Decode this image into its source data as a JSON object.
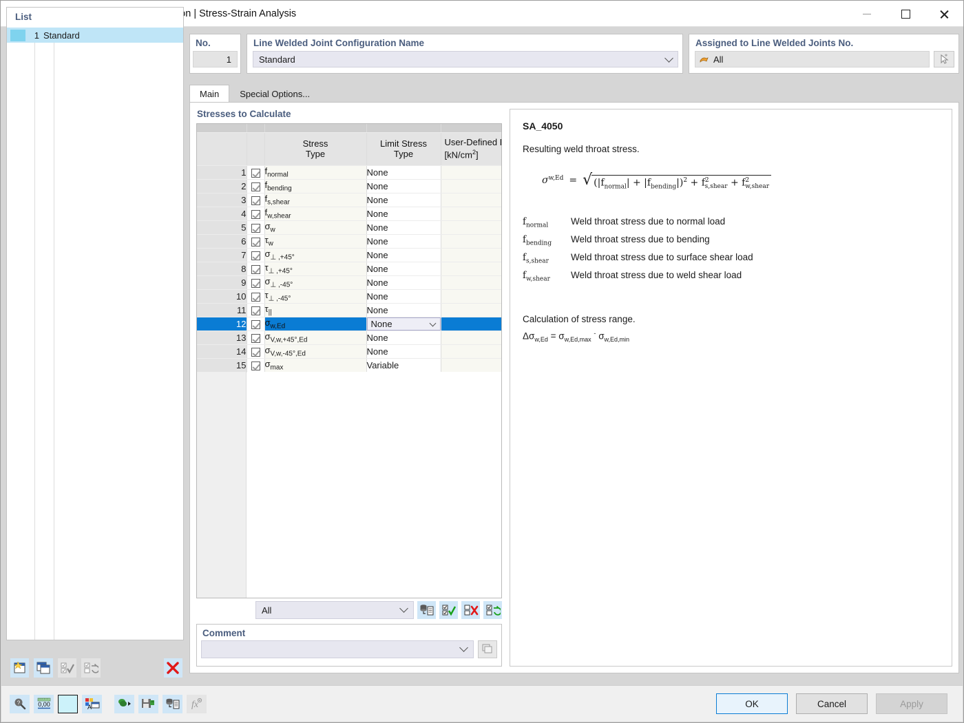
{
  "window": {
    "title": "New Line Welded Joint Configuration | Stress-Strain Analysis",
    "icon": "welded-joint-icon",
    "minimize": "minimize-icon",
    "maximize": "maximize-icon",
    "close": "close-icon"
  },
  "list": {
    "header": "List",
    "items": [
      {
        "number": "1",
        "name": "Standard"
      }
    ],
    "toolbar": [
      {
        "name": "new-item-button",
        "icon": "new-window-icon"
      },
      {
        "name": "copy-item-button",
        "icon": "copy-window-icon"
      },
      {
        "name": "select-all-button",
        "icon": "check-all-icon"
      },
      {
        "name": "invert-selection-button",
        "icon": "invert-check-icon"
      },
      {
        "name": "delete-item-button",
        "icon": "red-x-icon"
      }
    ]
  },
  "number_field": {
    "label": "No.",
    "value": "1"
  },
  "name_field": {
    "label": "Line Welded Joint Configuration Name",
    "value": "Standard",
    "chevron": "chevron-down-icon"
  },
  "assigned": {
    "label": "Assigned to Line Welded Joints No.",
    "value": "All",
    "value_icon": "selection-icon",
    "pick_button_icon": "pick-cursor-icon"
  },
  "tabs": [
    {
      "label": "Main",
      "active": true
    },
    {
      "label": "Special Options...",
      "active": false
    }
  ],
  "stresses": {
    "title": "Stresses to Calculate",
    "columns": {
      "number": "",
      "check": "",
      "type_line1": "Stress",
      "type_line2": "Type",
      "limit_line1": "Limit Stress",
      "limit_line2": "Type",
      "user_line1": "User-Defined L",
      "user_line2": "[kN/cm",
      "user_sup": "2",
      "user_line2_end": "]"
    },
    "rows": [
      {
        "no": "1",
        "checked": true,
        "type": "f",
        "sub": "normal",
        "limit": "None",
        "user": ""
      },
      {
        "no": "2",
        "checked": true,
        "type": "f",
        "sub": "bending",
        "limit": "None",
        "user": ""
      },
      {
        "no": "3",
        "checked": true,
        "type": "f",
        "sub": "s,shear",
        "limit": "None",
        "user": ""
      },
      {
        "no": "4",
        "checked": true,
        "type": "f",
        "sub": "w,shear",
        "limit": "None",
        "user": ""
      },
      {
        "no": "5",
        "checked": true,
        "type": "σ",
        "sub": "w",
        "limit": "None",
        "user": ""
      },
      {
        "no": "6",
        "checked": true,
        "type": "τ",
        "sub": "w",
        "limit": "None",
        "user": ""
      },
      {
        "no": "7",
        "checked": true,
        "type": "σ",
        "sub": "⊥ ,+45°",
        "limit": "None",
        "user": ""
      },
      {
        "no": "8",
        "checked": true,
        "type": "τ",
        "sub": "⊥ ,+45°",
        "limit": "None",
        "user": ""
      },
      {
        "no": "9",
        "checked": true,
        "type": "σ",
        "sub": "⊥ ,-45°",
        "limit": "None",
        "user": ""
      },
      {
        "no": "10",
        "checked": true,
        "type": "τ",
        "sub": "⊥ ,-45°",
        "limit": "None",
        "user": ""
      },
      {
        "no": "11",
        "checked": true,
        "type": "τ",
        "sub": "||",
        "limit": "None",
        "user": ""
      },
      {
        "no": "12",
        "checked": true,
        "type": "σ",
        "sub": "w,Ed",
        "limit": "None",
        "user": "",
        "selected": true
      },
      {
        "no": "13",
        "checked": true,
        "type": "σ",
        "sub": "V,w,+45°,Ed",
        "limit": "None",
        "user": ""
      },
      {
        "no": "14",
        "checked": true,
        "type": "σ",
        "sub": "V,w,-45°,Ed",
        "limit": "None",
        "user": ""
      },
      {
        "no": "15",
        "checked": true,
        "type": "σ",
        "sub": "max",
        "limit": "Variable",
        "user": ""
      }
    ],
    "filter": {
      "value": "All",
      "chevron": "chevron-down-icon"
    },
    "toolbar": [
      {
        "name": "import-from-library-button",
        "icon": "database-document-icon"
      },
      {
        "name": "check-all-button",
        "icon": "check-all-green-icon"
      },
      {
        "name": "uncheck-all-button",
        "icon": "uncheck-all-red-icon"
      },
      {
        "name": "invert-checks-button",
        "icon": "invert-checks-icon"
      }
    ]
  },
  "comment": {
    "label": "Comment",
    "value": "",
    "chevron": "chevron-down-icon",
    "button_icon": "comment-templates-icon"
  },
  "info": {
    "code": "SA_4050",
    "description": "Resulting weld throat stress.",
    "formula": {
      "lhs_sym": "σ",
      "lhs_sub": "w,Ed",
      "equals": "=",
      "radicand": "(|f_normal| + |f_bending|)² + f²_s,shear + f²_w,shear",
      "parts": {
        "open": "(|f",
        "p1sub": "normal",
        "bar1": "| + |f",
        "p2sub": "bending",
        "close": "|)",
        "sq": "2",
        "plus1": "+ f",
        "p3sub": "s,shear",
        "plus2": "+ f",
        "p4sub": "w,shear"
      }
    },
    "legend": [
      {
        "sym": "f",
        "sub": "normal",
        "text": "Weld throat stress due to normal load"
      },
      {
        "sym": "f",
        "sub": "bending",
        "text": "Weld throat stress due to bending"
      },
      {
        "sym": "f",
        "sub": "s,shear",
        "text": "Weld throat stress due to surface shear load"
      },
      {
        "sym": "f",
        "sub": "w,shear",
        "text": "Weld throat stress due to weld shear load"
      }
    ],
    "range_title": "Calculation of stress range.",
    "range_formula": {
      "delta": "Δσ",
      "delta_sub": "w,Ed",
      "eq": "=",
      "max_sym": "σ",
      "max_sub": "w,Ed,max",
      "minus": "-",
      "min_sym": "σ",
      "min_sub": "w,Ed,min"
    }
  },
  "statusbar": {
    "icons": [
      {
        "name": "info-search-button",
        "icon": "magnifier-question-icon"
      },
      {
        "name": "units-button",
        "icon": "number-format-icon"
      },
      {
        "name": "color-swatch-button",
        "icon": "color-swatch-icon"
      },
      {
        "name": "display-properties-button",
        "icon": "display-properties-icon"
      },
      {
        "name": "export-button",
        "icon": "export-green-icon"
      },
      {
        "name": "save-button",
        "icon": "save-green-icon"
      },
      {
        "name": "library-button",
        "icon": "database-document-icon"
      },
      {
        "name": "formula-button",
        "icon": "fx-icon"
      }
    ],
    "buttons": {
      "ok": "OK",
      "cancel": "Cancel",
      "apply": "Apply"
    }
  },
  "colors": {
    "selection_blue": "#0a7cd4",
    "panel_label": "#4a5d7e",
    "list_selection": "#bfe5f7",
    "toolbar_button": "#cfe6f7"
  }
}
